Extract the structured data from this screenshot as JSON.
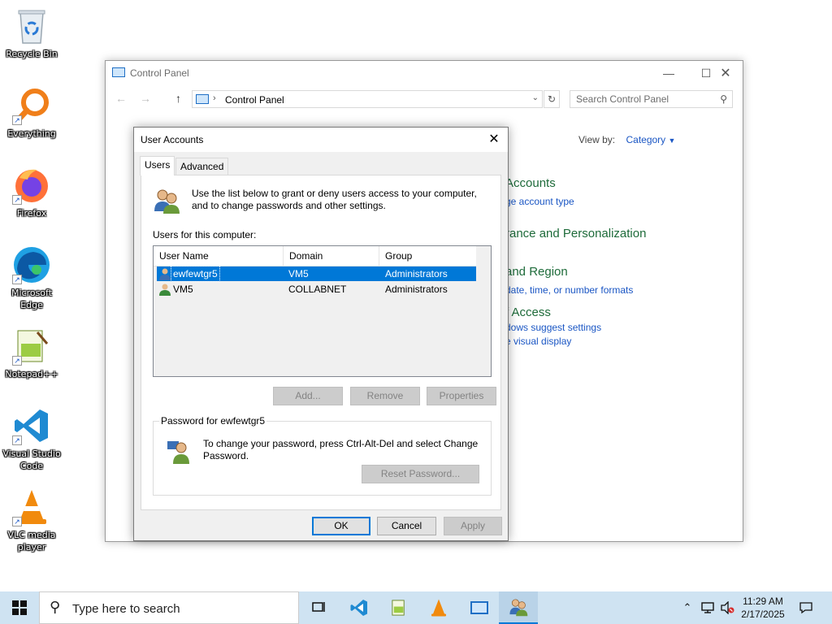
{
  "desktop": {
    "icons": [
      {
        "label": "Recycle Bin"
      },
      {
        "label": "Everything"
      },
      {
        "label": "Firefox"
      },
      {
        "label": "Microsoft Edge"
      },
      {
        "label": "Notepad++"
      },
      {
        "label": "Visual Studio Code"
      },
      {
        "label": "VLC media player"
      }
    ]
  },
  "control_panel": {
    "title": "Control Panel",
    "address": "Control Panel",
    "search_placeholder": "Search Control Panel",
    "view_by_label": "View by:",
    "view_by_value": "Category",
    "categories": [
      {
        "heading": "Accounts",
        "link": "ge account type"
      },
      {
        "heading": "rance and Personalization"
      },
      {
        "heading": "and Region",
        "link": "date, time, or number formats"
      },
      {
        "heading": "f Access",
        "links": [
          "dows suggest settings",
          "e visual display"
        ]
      }
    ]
  },
  "user_accounts": {
    "title": "User Accounts",
    "tabs": [
      "Users",
      "Advanced"
    ],
    "intro": "Use the list below to grant or deny users access to your computer, and to change passwords and other settings.",
    "users_label": "Users for this computer:",
    "columns": [
      "User Name",
      "Domain",
      "Group"
    ],
    "rows": [
      {
        "user": "ewfewtgr5",
        "domain": "VM5",
        "group": "Administrators",
        "selected": true
      },
      {
        "user": "VM5",
        "domain": "COLLABNET",
        "group": "Administrators",
        "selected": false
      }
    ],
    "buttons": {
      "add": "Add...",
      "remove": "Remove",
      "properties": "Properties"
    },
    "password_group": {
      "legend": "Password for ewfewtgr5",
      "text": "To change your password, press Ctrl-Alt-Del and select Change Password.",
      "reset": "Reset Password..."
    },
    "footer": {
      "ok": "OK",
      "cancel": "Cancel",
      "apply": "Apply"
    }
  },
  "taskbar": {
    "search_placeholder": "Type here to search",
    "time": "11:29 AM",
    "date": "2/17/2025"
  },
  "colors": {
    "accent": "#0078d7",
    "taskbar": "#cfe3f2",
    "link": "#1a56c4"
  }
}
